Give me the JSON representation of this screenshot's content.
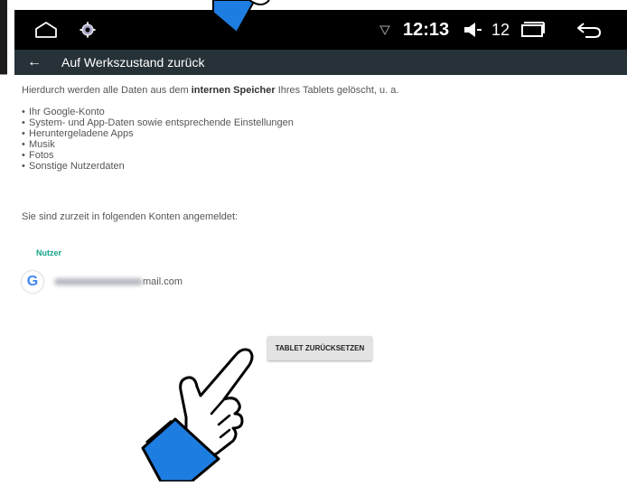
{
  "statusbar": {
    "time": "12:13",
    "volume_level": "12"
  },
  "toolbar": {
    "title": "Auf Werkszustand zurück"
  },
  "content": {
    "intro_prefix": "Hierdurch werden alle Daten aus dem ",
    "intro_bold": "internen Speicher",
    "intro_suffix": " Ihres Tablets gelöscht, u. a.",
    "bullets": [
      "Ihr Google-Konto",
      "System- und App-Daten sowie entsprechende Einstellungen",
      "Heruntergeladene Apps",
      "Musik",
      "Fotos",
      "Sonstige Nutzerdaten"
    ],
    "accounts_text": "Sie sind zurzeit in folgenden Konten angemeldet:",
    "section_label": "Nutzer",
    "account_email_suffix": "mail.com",
    "google_letter": "G"
  },
  "actions": {
    "reset_label": "TABLET ZURÜCKSETZEN"
  },
  "colors": {
    "toolbar_bg": "#263238",
    "accent_teal": "#14a58a",
    "hand_cuff": "#1e7de0"
  },
  "icons": [
    "home-icon",
    "settings-gear-icon",
    "location-icon",
    "volume-icon",
    "recents-icon",
    "back-icon",
    "pointing-hand-icon"
  ]
}
